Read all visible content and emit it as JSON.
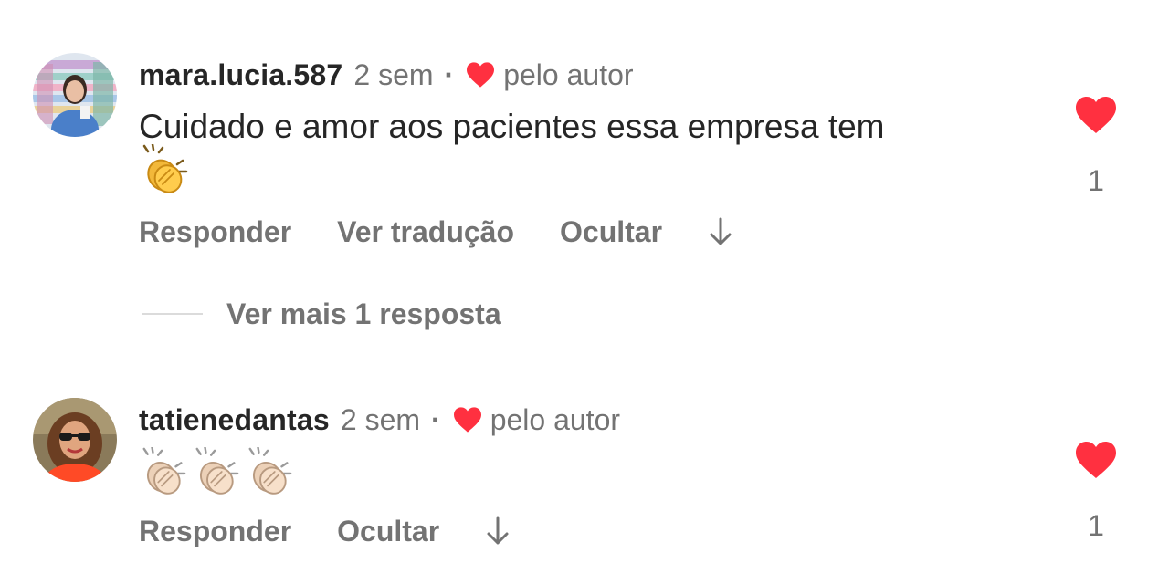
{
  "comments": [
    {
      "username": "mara.lucia.587",
      "time": "2 sem",
      "separator": "·",
      "liked_by_author": "pelo autor",
      "text": "Cuidado e amor aos pacientes essa empresa tem",
      "emojis": [
        "clapping-hands-emoji"
      ],
      "actions": {
        "reply": "Responder",
        "translate": "Ver tradução",
        "hide": "Ocultar"
      },
      "likes": "1",
      "more_replies": "Ver mais 1 resposta"
    },
    {
      "username": "tatienedantas",
      "time": "2 sem",
      "separator": "·",
      "liked_by_author": "pelo autor",
      "emojis": [
        "clapping-hands-emoji-light",
        "clapping-hands-emoji-light",
        "clapping-hands-emoji-light"
      ],
      "actions": {
        "reply": "Responder",
        "hide": "Ocultar"
      },
      "likes": "1"
    }
  ],
  "colors": {
    "heart_red": "#ff3040",
    "secondary_text": "#737373",
    "primary_text": "#262626"
  }
}
